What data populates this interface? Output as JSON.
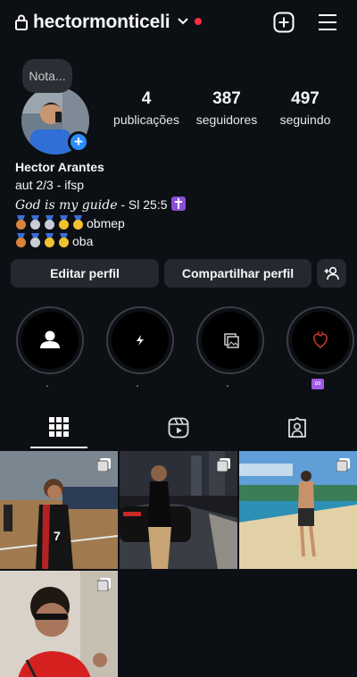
{
  "header": {
    "username": "hectormonticeli",
    "icons": [
      "lock-icon",
      "chevron-down-icon",
      "new-post-icon",
      "menu-icon"
    ],
    "accent_color": "#ff2d40"
  },
  "note": {
    "text": "Nota..."
  },
  "stats": [
    {
      "value": "4",
      "label": "publicações"
    },
    {
      "value": "387",
      "label": "seguidores"
    },
    {
      "value": "497",
      "label": "seguindo"
    }
  ],
  "profile": {
    "name": "Hector Arantes",
    "bio_line1": "aut 2/3 - ifsp",
    "bio_quote": "God is my guide",
    "bio_verse": " - Sl 25:5",
    "medals_line1_text": "obmep",
    "medals_line2_text": "oba"
  },
  "buttons": {
    "edit": "Editar perfil",
    "share": "Compartilhar perfil"
  },
  "highlights": [
    {
      "label": ".",
      "icon": "person-icon"
    },
    {
      "label": ".",
      "icon": "bolt-icon"
    },
    {
      "label": ".",
      "icon": "photos-icon"
    },
    {
      "label": "∞",
      "icon": "heart-icon"
    }
  ],
  "tabs": [
    {
      "name": "grid",
      "icon": "grid-icon",
      "active": true
    },
    {
      "name": "reels",
      "icon": "reels-icon",
      "active": false
    },
    {
      "name": "tagged",
      "icon": "tagged-icon",
      "active": false
    }
  ]
}
